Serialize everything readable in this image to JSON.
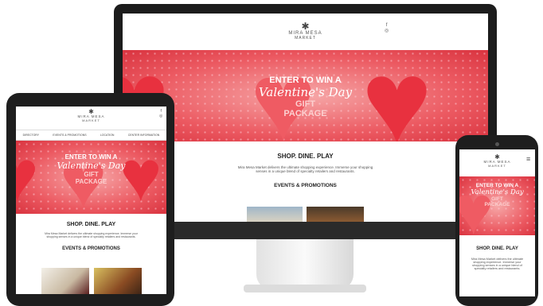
{
  "site": {
    "logo_line1": "MIRA MESA",
    "logo_line2": "MARKET",
    "logo_mark": "✱",
    "hamburger": "≡"
  },
  "nav": {
    "items": [
      "DIRECTORY",
      "EVENTS & PROMOTIONS",
      "LOCATION",
      "CENTER INFORMATION"
    ]
  },
  "social": {
    "facebook": "f",
    "instagram": "◎"
  },
  "hero": {
    "line1": "ENTER TO WIN A",
    "line2": "Valentine's Day",
    "line3": "GIFT",
    "line4": "PACKAGE"
  },
  "content": {
    "heading": "SHOP. DINE. PLAY",
    "intro": "Mira Mesa Market delivers the ultimate shopping experience. Immerse your shopping senses in a unique blend of specialty retailers and restaurants.",
    "events_heading": "EVENTS & PROMOTIONS"
  },
  "colors": {
    "hero_red": "#e8313f",
    "device_dark": "#1c1c1c"
  }
}
